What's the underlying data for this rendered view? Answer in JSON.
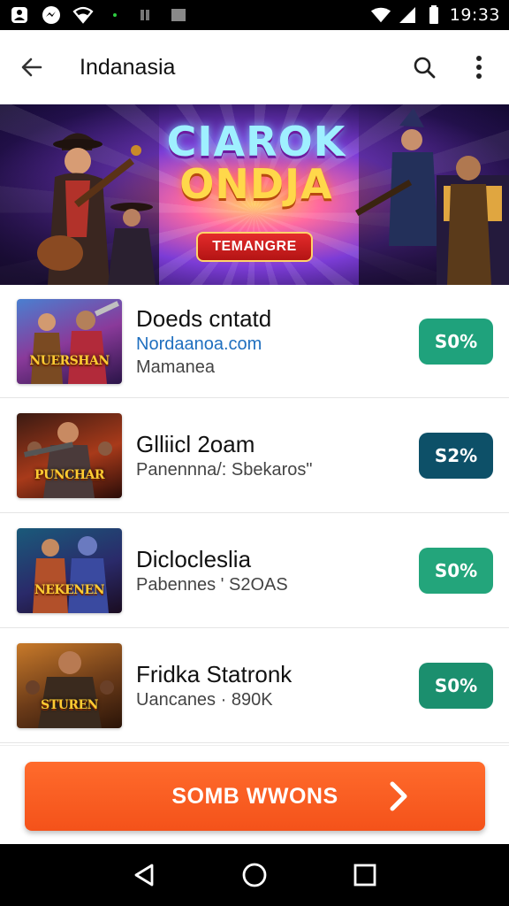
{
  "status_bar": {
    "time": "19:33",
    "icons": [
      "account-icon",
      "messenger-icon",
      "wifi-icon",
      "signal-icon",
      "battery-icon"
    ]
  },
  "app_bar": {
    "title": "Indanasia",
    "icons": [
      "back-arrow-icon",
      "search-icon",
      "more-vertical-icon"
    ]
  },
  "banner": {
    "title_line1": "CIAROK",
    "title_line2": "ONDJA",
    "tag": "TEMANGRE"
  },
  "list": {
    "items": [
      {
        "title": "Doeds cntatd",
        "link": "Nordaanoa.com",
        "subtitle": "Mamanea",
        "thumb_text": "NUERSHAN",
        "percent": "S0%",
        "color": "#1fa27c"
      },
      {
        "title": "Glliicl 2oam",
        "subtitle": "Panennna/: Sbekaros\"",
        "thumb_text": "PUNCHAR",
        "percent": "S2%",
        "color": "#0d5068"
      },
      {
        "title": "Diclocleslia",
        "subtitle": "Pabennes ' S2OAS",
        "thumb_text": "NEKENEN",
        "percent": "S0%",
        "color": "#23a57b"
      },
      {
        "title": "Fridka Statronk",
        "subtitle": "Uancanes · 890K",
        "thumb_text": "STUREN",
        "percent": "S0%",
        "color": "#1b8f6e"
      }
    ]
  },
  "cta": {
    "label": "SOMB WWONS",
    "color": "#f4521a"
  },
  "nav": {
    "icons": [
      "back-triangle-icon",
      "home-circle-icon",
      "recents-square-icon"
    ]
  }
}
